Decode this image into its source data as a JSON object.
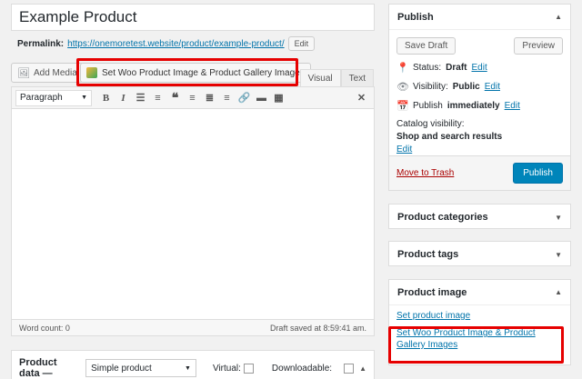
{
  "post": {
    "title": "Example Product",
    "permalink_label": "Permalink:",
    "permalink_url": "https://onemoretest.website/product/example-product/",
    "edit_label": "Edit"
  },
  "media": {
    "add_media_label": "Add Media",
    "woo_button_label": "Set Woo Product Image & Product Gallery Images"
  },
  "editor": {
    "tabs": [
      "Visual",
      "Text"
    ],
    "format_select": "Paragraph",
    "word_count": "Word count: 0",
    "draft_saved": "Draft saved at 8:59:41 am.",
    "toolbar_icons": [
      "bold-icon",
      "italic-icon",
      "bullet-list-icon",
      "numbered-list-icon",
      "blockquote-icon",
      "align-left-icon",
      "align-center-icon",
      "align-right-icon",
      "link-icon",
      "read-more-icon",
      "toolbar-toggle-icon",
      "fullscreen-icon"
    ]
  },
  "product_data": {
    "title": "Product data —",
    "type_select": "Simple product",
    "virtual_label": "Virtual:",
    "downloadable_label": "Downloadable:"
  },
  "publish": {
    "title": "Publish",
    "save_draft": "Save Draft",
    "preview": "Preview",
    "status_label": "Status:",
    "status_value": "Draft",
    "visibility_label": "Visibility:",
    "visibility_value": "Public",
    "publish_label": "Publish",
    "publish_value": "immediately",
    "catalog_label": "Catalog visibility:",
    "catalog_value": "Shop and search results",
    "edit_link": "Edit",
    "trash": "Move to Trash",
    "publish_button": "Publish"
  },
  "boxes": {
    "categories": "Product categories",
    "tags": "Product tags",
    "image": "Product image",
    "set_image_link": "Set product image",
    "set_woo_link": "Set Woo Product Image & Product Gallery Images"
  },
  "colors": {
    "highlight": "#e60000",
    "link": "#0073aa",
    "primary": "#0085ba",
    "trash": "#aa0000"
  }
}
